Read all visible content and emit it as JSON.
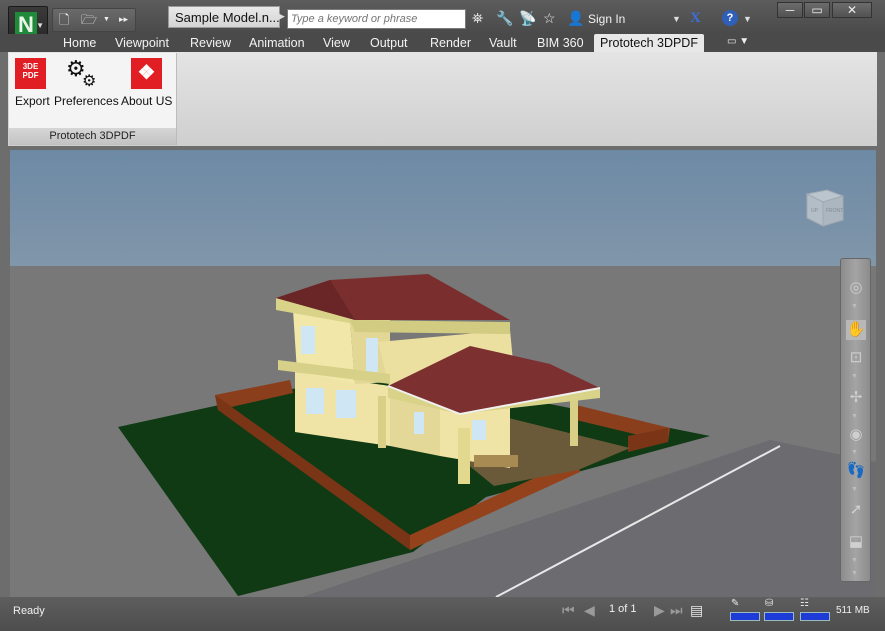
{
  "window": {
    "document_title": "Sample Model.n...",
    "search_placeholder": "Type a keyword or phrase",
    "sign_in": "Sign In",
    "help": "?",
    "app_letter": "N"
  },
  "ribbon": {
    "tabs": [
      "Home",
      "Viewpoint",
      "Review",
      "Animation",
      "View",
      "Output",
      "Render",
      "Vault",
      "BIM 360"
    ],
    "active_tab": "Prototech 3DPDF",
    "panel_title": "Prototech 3DPDF",
    "buttons": {
      "export": "Export",
      "preferences": "Preferences",
      "about": "About US"
    },
    "export_icon_text": "3DE PDF"
  },
  "viewcube": {
    "top": "UP",
    "front": "FRONT"
  },
  "statusbar": {
    "status": "Ready",
    "page_info": "1 of 1",
    "memory": "511 MB"
  },
  "colors": {
    "accent_red": "#e01e24",
    "roof": "#7a2e2e",
    "walls": "#f1e7a8",
    "trim": "#d9d38a",
    "lawn": "#0f3a14",
    "fence": "#8a3e1c",
    "road": "#6f6f72"
  },
  "icons": [
    "new-file-icon",
    "open-folder-icon",
    "binoculars-icon",
    "tools-icon",
    "antenna-icon",
    "star-icon",
    "user-icon",
    "close-x-icon",
    "help-icon",
    "gear-icon",
    "steering-wheel-icon",
    "hand-pan-icon",
    "zoom-icon",
    "orbit-icon",
    "look-icon",
    "walk-icon",
    "select-icon",
    "camera-icon"
  ]
}
